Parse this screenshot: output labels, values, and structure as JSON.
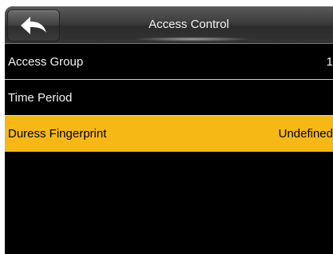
{
  "header": {
    "title": "Access Control",
    "back_icon": "back-arrow-icon"
  },
  "menu": {
    "items": [
      {
        "label": "Access Group",
        "value": "1"
      },
      {
        "label": "Time Period",
        "value": ""
      },
      {
        "label": "Duress Fingerprint",
        "value": "Undefined",
        "selected": true
      }
    ]
  },
  "colors": {
    "selected_bg": "#f5b815",
    "screen_bg": "#000000"
  }
}
